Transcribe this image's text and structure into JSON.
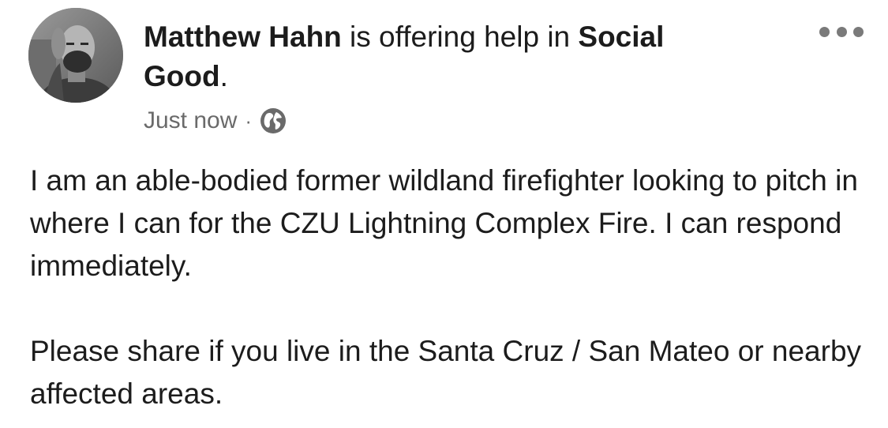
{
  "post": {
    "author": "Matthew Hahn",
    "action_text": " is offering help in ",
    "group_line1": "Social",
    "group_line2": "Good",
    "end_period": ".",
    "timestamp": "Just now",
    "separator": "·",
    "audience_icon": "globe-icon",
    "more_icon": "more-options-icon",
    "paragraphs": [
      "I am an able-bodied former wildland firefighter looking to pitch in where I can for the CZU Lightning Complex Fire. I can respond immediately.",
      "Please share if you live in the Santa Cruz / San Mateo or nearby affected areas."
    ]
  },
  "colors": {
    "text": "#1c1c1c",
    "meta_text": "#6a6a6a",
    "more_dots": "#7a7a7a",
    "background": "#ffffff"
  }
}
